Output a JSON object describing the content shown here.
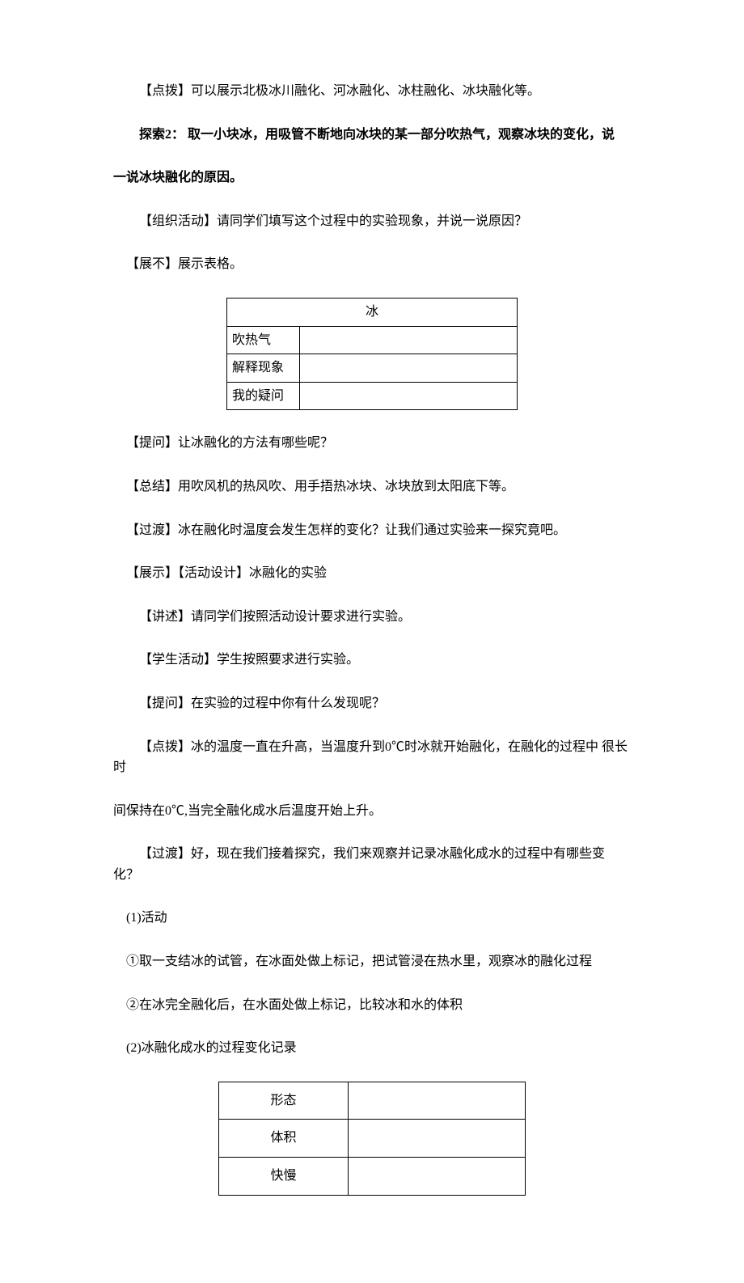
{
  "p1": "【点拨】可以展示北极冰川融化、河冰融化、冰柱融化、冰块融化等。",
  "p2a": "探索2： 取一小块冰，用吸管不断地向冰块的某一部分吹热气，观察冰块的变化，说",
  "p2b": "一说冰块融化的原因。",
  "p3": "【组织活动】请同学们填写这个过程中的实验现象，并说一说原因？",
  "p4": "【展不】展示表格。",
  "table1": {
    "header": "冰",
    "rows": [
      {
        "label": "吹热气",
        "value": ""
      },
      {
        "label": "解释现象",
        "value": ""
      },
      {
        "label": "我的疑问",
        "value": ""
      }
    ]
  },
  "p5": "【提问】让冰融化的方法有哪些呢？",
  "p6": "【总结】用吹风机的热风吹、用手捂热冰块、冰块放到太阳底下等。",
  "p7": "【过渡】冰在融化时温度会发生怎样的变化？让我们通过实验来一探究竟吧。",
  "p8": "【展示】【活动设计】冰融化的实验",
  "p9": "【讲述】请同学们按照活动设计要求进行实验。",
  "p10": "【学生活动】学生按照要求进行实验。",
  "p11": "【提问】在实验的过程中你有什么发现呢？",
  "p12a": "【点拨】冰的温度一直在升高，当温度升到0℃时冰就开始融化，在融化的过程中 很长时",
  "p12b": "间保持在0℃,当完全融化成水后温度开始上升。",
  "p13": "【过渡】好，现在我们接着探究，我们来观察并记录冰融化成水的过程中有哪些变 化？",
  "p14": "(1)活动",
  "p15": "①取一支结冰的试管，在冰面处做上标记，把试管浸在热水里，观察冰的融化过程",
  "p16": "②在冰完全融化后，在水面处做上标记，比较冰和水的体积",
  "p17": "(2)冰融化成水的过程变化记录",
  "table2": {
    "rows": [
      {
        "label": "形态",
        "value": ""
      },
      {
        "label": "体积",
        "value": ""
      },
      {
        "label": "快慢",
        "value": ""
      }
    ]
  }
}
